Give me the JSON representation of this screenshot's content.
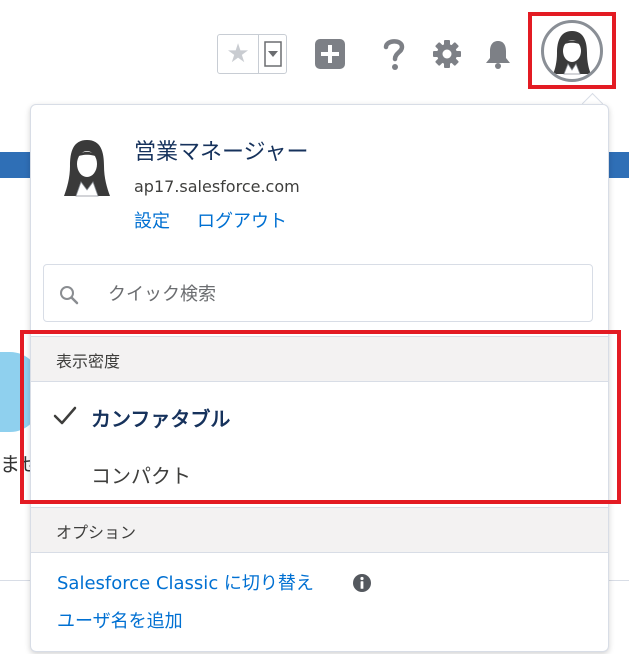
{
  "header": {
    "favorite_icon": "star-icon",
    "favorites_dropdown_icon": "chevron-down-icon",
    "add_icon": "plus-icon",
    "help_icon": "question-icon",
    "setup_icon": "gear-icon",
    "notifications_icon": "bell-icon",
    "avatar_icon": "user-avatar-icon"
  },
  "background": {
    "partial_text": "ませ"
  },
  "user_menu": {
    "profile_name": "営業マネージャー",
    "domain": "ap17.salesforce.com",
    "settings_link": "設定",
    "logout_link": "ログアウト",
    "quick_search_placeholder": "クイック検索"
  },
  "density": {
    "header": "表示密度",
    "options": [
      {
        "label": "カンファタブル",
        "selected": true
      },
      {
        "label": "コンパクト",
        "selected": false
      }
    ]
  },
  "options": {
    "header": "オプション",
    "switch_classic_link": "Salesforce Classic に切り替え",
    "add_username_link": "ユーザ名を追加"
  },
  "colors": {
    "link": "#0070d2",
    "highlight": "#e31b23",
    "section_header_bg": "#f3f2f2",
    "icon_gray": "#7d8086"
  }
}
